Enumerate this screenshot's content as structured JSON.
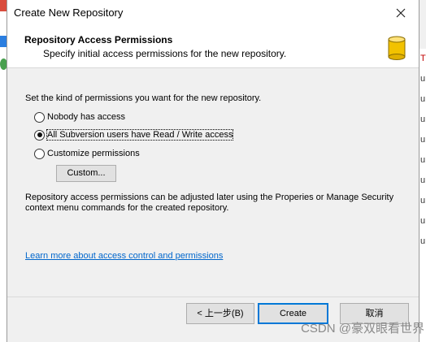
{
  "dialog": {
    "title": "Create New Repository"
  },
  "header": {
    "title": "Repository Access Permissions",
    "subtitle": "Specify initial access permissions for the new repository."
  },
  "body": {
    "intro": "Set the kind of permissions you want for the new repository.",
    "options": [
      {
        "label": "Nobody has access",
        "checked": false
      },
      {
        "label": "All Subversion users have Read / Write access",
        "checked": true
      },
      {
        "label": "Customize permissions",
        "checked": false
      }
    ],
    "custom_button": "Custom...",
    "note": "Repository access permissions can be adjusted later using the Properies or Manage Security context menu commands for the created repository.",
    "link": "Learn more about access control and permissions"
  },
  "footer": {
    "back": "< 上一步(B)",
    "create": "Create",
    "cancel": "取消"
  },
  "background": {
    "right_rows": [
      "T",
      "u",
      "u",
      "u",
      "u",
      "u",
      "u",
      "u",
      "u",
      "u"
    ]
  },
  "watermark": "CSDN @豪双眼看世界",
  "colors": {
    "link": "#0066cc",
    "focus_border": "#0078d7",
    "db_icon": "#f2c200"
  }
}
